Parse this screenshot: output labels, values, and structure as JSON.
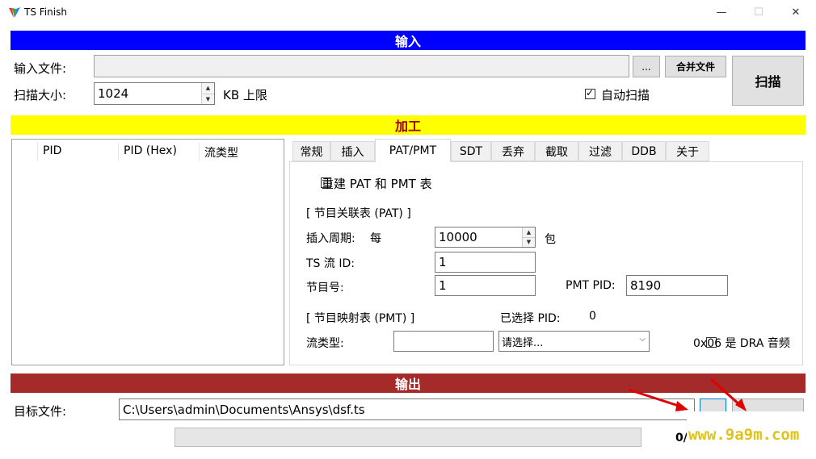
{
  "window": {
    "title": "TS Finish",
    "min_glyph": "—",
    "max_glyph": "☐",
    "close_glyph": "✕"
  },
  "input_section": {
    "banner": "输入",
    "file_label": "输入文件:",
    "file_value": "",
    "browse_label": "...",
    "merge_label": "合并文件",
    "size_label": "扫描大小:",
    "size_value": "1024",
    "size_unit": "KB 上限",
    "auto_scan_label": "自动扫描",
    "auto_scan_checked": true,
    "scan_label": "扫描"
  },
  "process_section": {
    "banner": "加工",
    "pid_columns": [
      "PID",
      "PID (Hex)",
      "流类型"
    ],
    "tabs": [
      "常规",
      "插入",
      "PAT/PMT",
      "SDT",
      "丢弃",
      "截取",
      "过滤",
      "DDB",
      "关于"
    ],
    "active_tab": "PAT/PMT",
    "rebuild_label": "重建 PAT 和 PMT 表",
    "pat_group": "[ 节目关联表 (PAT) ]",
    "period_label": "插入周期:",
    "period_each": "每",
    "period_value": "10000",
    "period_unit": "包",
    "ts_id_label": "TS 流 ID:",
    "ts_id_value": "1",
    "program_label": "节目号:",
    "program_value": "1",
    "pmt_pid_label": "PMT PID:",
    "pmt_pid_value": "8190",
    "pmt_group": "[ 节目映射表 (PMT) ]",
    "selected_pid_label": "已选择 PID:",
    "selected_pid_value": "0",
    "stream_type_label": "流类型:",
    "stream_type_value": "",
    "stream_select": "请选择...",
    "dra_label": "0x06 是 DRA 音频"
  },
  "output_section": {
    "banner": "输出",
    "target_label": "目标文件:",
    "target_value": "C:\\Users\\admin\\Documents\\Ansys\\dsf.ts",
    "progress_text": "0/",
    "progress": 0
  },
  "watermark": {
    "text": "www.9a9m.com"
  },
  "colors": {
    "input_banner": "#0000ff",
    "process_banner": "#ffff00",
    "output_banner": "#a52a2a",
    "arrow": "#e00000"
  }
}
